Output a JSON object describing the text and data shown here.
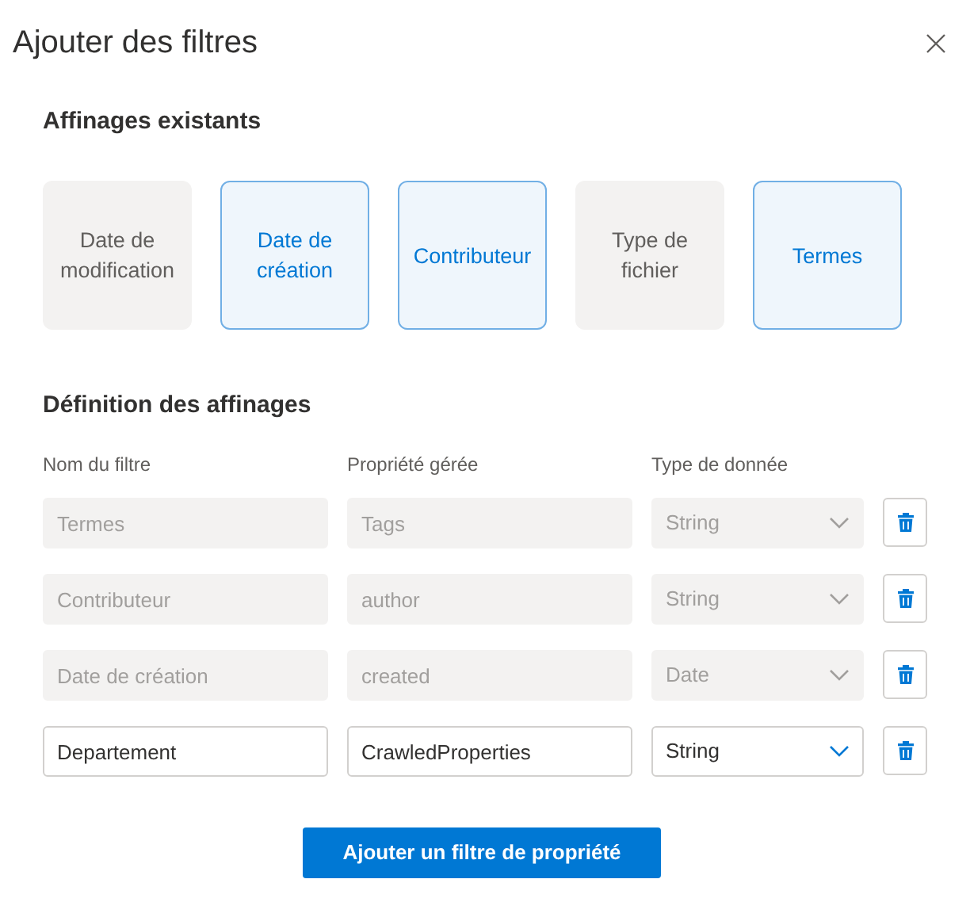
{
  "dialog": {
    "title": "Ajouter des filtres"
  },
  "existing": {
    "heading": "Affinages existants",
    "tiles": [
      {
        "label": "Date de modification",
        "selected": false
      },
      {
        "label": "Date de création",
        "selected": true
      },
      {
        "label": "Contributeur",
        "selected": true
      },
      {
        "label": "Type de fichier",
        "selected": false
      },
      {
        "label": "Termes",
        "selected": true
      }
    ]
  },
  "definitions": {
    "heading": "Définition des affinages",
    "columns": [
      "Nom du filtre",
      "Propriété gérée",
      "Type de donnée"
    ],
    "rows": [
      {
        "filter_name": "Termes",
        "managed_property": "Tags",
        "data_type": "String",
        "disabled": true
      },
      {
        "filter_name": "Contributeur",
        "managed_property": "author",
        "data_type": "String",
        "disabled": true
      },
      {
        "filter_name": "Date de création",
        "managed_property": "created",
        "data_type": "Date",
        "disabled": true
      },
      {
        "filter_name": "Departement",
        "managed_property": "CrawledProperties",
        "data_type": "String",
        "disabled": false
      }
    ]
  },
  "add_button": "Ajouter un filtre de propriété"
}
